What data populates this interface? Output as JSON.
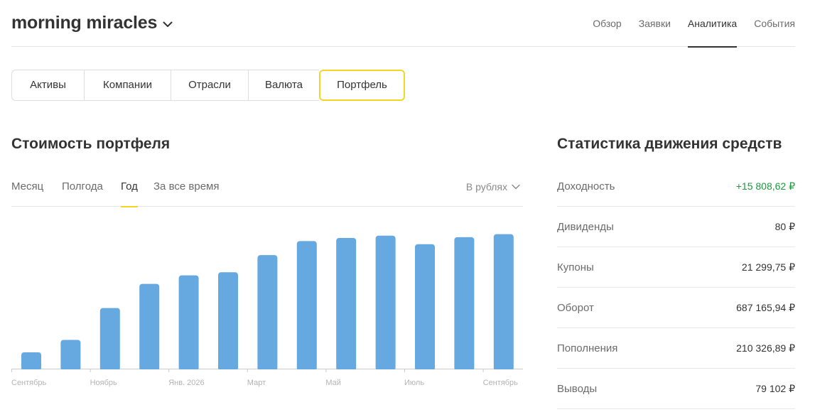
{
  "header": {
    "account_name": "morning miracles",
    "nav": [
      "Обзор",
      "Заявки",
      "Аналитика",
      "События"
    ],
    "active_nav": 2
  },
  "segments": {
    "items": [
      "Активы",
      "Компании",
      "Отрасли",
      "Валюта",
      "Портфель"
    ],
    "active": 4
  },
  "portfolio": {
    "title": "Стоимость портфеля",
    "periods": [
      "Месяц",
      "Полгода",
      "Год",
      "За все время"
    ],
    "active_period": 2,
    "currency_select": "В рублях"
  },
  "chart_data": {
    "type": "bar",
    "title": "",
    "xlabel": "",
    "ylabel": "",
    "x_tick_labels": [
      "Сентябрь",
      "Ноябрь",
      "Янв. 2026",
      "Март",
      "Май",
      "Июль",
      "Сентябрь"
    ],
    "relative_values": [
      0.105,
      0.185,
      0.39,
      0.545,
      0.6,
      0.62,
      0.73,
      0.82,
      0.84,
      0.855,
      0.8,
      0.845,
      0.865
    ],
    "ylim": [
      0,
      1
    ],
    "grid": false,
    "bar_color": "#66a8e0"
  },
  "stats": {
    "title": "Статистика движения средств",
    "rows": [
      {
        "label": "Доходность",
        "value": "+15 808,62 ₽",
        "positive": true
      },
      {
        "label": "Дивиденды",
        "value": "80 ₽",
        "positive": false
      },
      {
        "label": "Купоны",
        "value": "21 299,75 ₽",
        "positive": false
      },
      {
        "label": "Оборот",
        "value": "687 165,94 ₽",
        "positive": false
      },
      {
        "label": "Пополнения",
        "value": "210 326,89 ₽",
        "positive": false
      },
      {
        "label": "Выводы",
        "value": "79 102 ₽",
        "positive": false
      }
    ]
  },
  "colors": {
    "accent_yellow": "#f5d428",
    "positive_green": "#1a9b3c",
    "bar_blue": "#66a8e0"
  }
}
